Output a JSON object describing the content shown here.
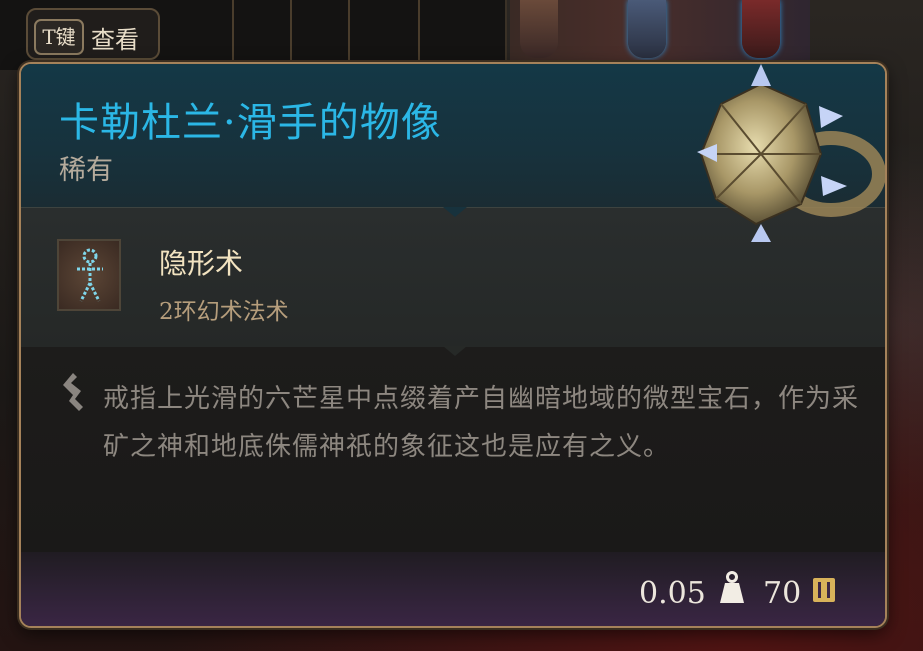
{
  "hotkey": {
    "key": "T键",
    "label": "查看"
  },
  "item": {
    "name": "卡勒杜兰·滑手的物像",
    "rarity": "稀有",
    "spell": {
      "name": "隐形术",
      "subtitle": "2环幻术法术"
    },
    "description": "戒指上光滑的六芒星中点缀着产自幽暗地域的微型宝石，作为采矿之神和地底侏儒神祇的象征这也是应有之义。",
    "weight": "0.05",
    "price": "70"
  },
  "colors": {
    "title": "#2bb7e6",
    "rarity": "#b5ab9c",
    "spell_name": "#f2e3c0",
    "border": "#a5825a"
  },
  "icons": {
    "quote": "quote-mark-icon",
    "weight": "weight-icon",
    "gold": "gold-coin-icon",
    "spell": "invisibility-spell-icon",
    "item": "ring-item-icon"
  }
}
